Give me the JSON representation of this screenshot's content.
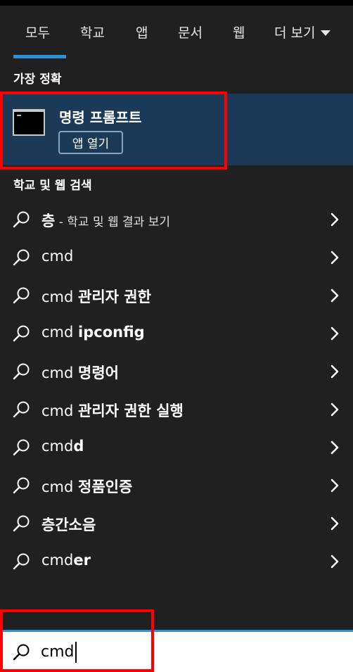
{
  "tabs": [
    {
      "label": "모두",
      "active": true
    },
    {
      "label": "학교"
    },
    {
      "label": "앱"
    },
    {
      "label": "문서"
    },
    {
      "label": "웹"
    },
    {
      "label": "더 보기"
    }
  ],
  "best_match": {
    "section_label": "가장 정확",
    "title": "명령 프롬프트",
    "open_label": "앱 열기"
  },
  "web_search": {
    "section_label": "학교 및 웹 검색",
    "results": [
      {
        "plain": "",
        "bold": "층",
        "suffix": " - 학교 및 웹 결과 보기"
      },
      {
        "plain": "cmd",
        "bold": "",
        "suffix": ""
      },
      {
        "plain": "cmd ",
        "bold": "관리자 권한",
        "suffix": ""
      },
      {
        "plain": "cmd ",
        "bold": "ipconfig",
        "suffix": ""
      },
      {
        "plain": "cmd ",
        "bold": "명령어",
        "suffix": ""
      },
      {
        "plain": "cmd ",
        "bold": "관리자 권한 실행",
        "suffix": ""
      },
      {
        "plain": "cmd",
        "bold": "d",
        "suffix": ""
      },
      {
        "plain": "cmd ",
        "bold": "정품인증",
        "suffix": ""
      },
      {
        "plain": "",
        "bold": "층간소음",
        "suffix": ""
      },
      {
        "plain": "cmd",
        "bold": "er",
        "suffix": ""
      }
    ]
  },
  "search": {
    "value": "cmd"
  },
  "colors": {
    "accent": "#2e8fd6",
    "highlight": "#1a3a57",
    "annotation": "#ff0000"
  },
  "icons": [
    "search-icon",
    "chevron-right-icon",
    "command-prompt-icon",
    "caret-down-icon"
  ]
}
